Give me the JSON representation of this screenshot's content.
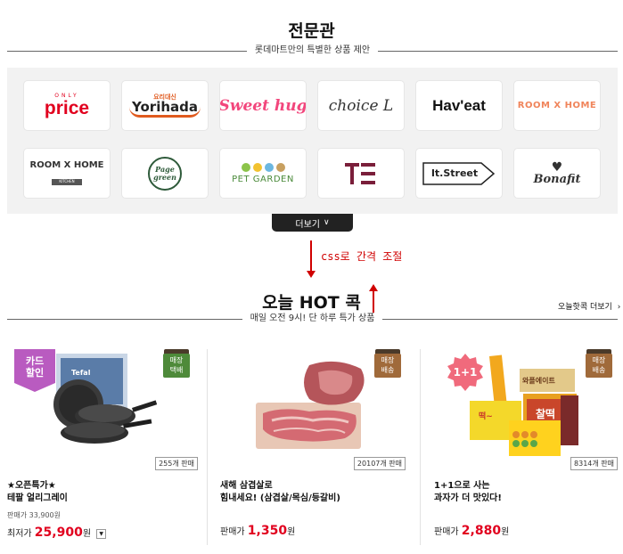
{
  "specialty": {
    "title": "전문관",
    "subtitle": "롯데마트만의 특별한 상품 제안",
    "more_label": "더보기",
    "brands": [
      "price",
      "Yorihada",
      "Sweet hug",
      "choice L",
      "Hav'eat",
      "ROOM X HOME",
      "ROOM X HOME",
      "Page green",
      "PET GARDEN",
      "TE",
      "It.Street",
      "Bonafit"
    ],
    "brand_extras": {
      "price_top": "ONLY",
      "yorihada_top": "요리대신",
      "roomhome_kitchen": "KITCHEN"
    }
  },
  "annotation": {
    "text": "css로 간격 조절"
  },
  "hot": {
    "title": "오늘 HOT 콕",
    "subtitle": "매일 오전 9시! 단 하루 특가 상품",
    "more_label": "오늘핫콕 더보기",
    "products": [
      {
        "badge_line1": "매장",
        "badge_line2": "택배",
        "card_badge_line1": "카드",
        "card_badge_line2": "할인",
        "sold": "255개 판매",
        "title_line1": "★오픈특가★",
        "title_line2": "테팔 얼리그레이",
        "orig_label": "판매가",
        "orig_price": "33,900원",
        "price_label": "최저가",
        "price": "25,900",
        "won": "원",
        "brand_on_box": "Tefal"
      },
      {
        "badge_line1": "매장",
        "badge_line2": "배송",
        "sold": "20107개 판매",
        "title_line1": "새해 삼겹살로",
        "title_line2": "힘내세요! (삼겹살/목심/등갈비)",
        "price_label": "판매가",
        "price": "1,350",
        "won": "원"
      },
      {
        "badge_line1": "매장",
        "badge_line2": "배송",
        "promo_badge": "1+1",
        "sold": "8314개 판매",
        "title_line1": "1+1으로 사는",
        "title_line2": "과자가 더 맛있다!",
        "price_label": "판매가",
        "price": "2,880",
        "won": "원",
        "box_text_1": "와플에이트",
        "box_text_2": "찰떡",
        "box_text_3": "떡~"
      }
    ]
  },
  "colors": {
    "accent_red": "#e1001e",
    "badge_green": "#4e8a3a",
    "badge_brown": "#a06a3a",
    "card_badge_purple": "#b95bc0",
    "promo_pink": "#f06a7c",
    "annotation_red": "#d00000"
  }
}
